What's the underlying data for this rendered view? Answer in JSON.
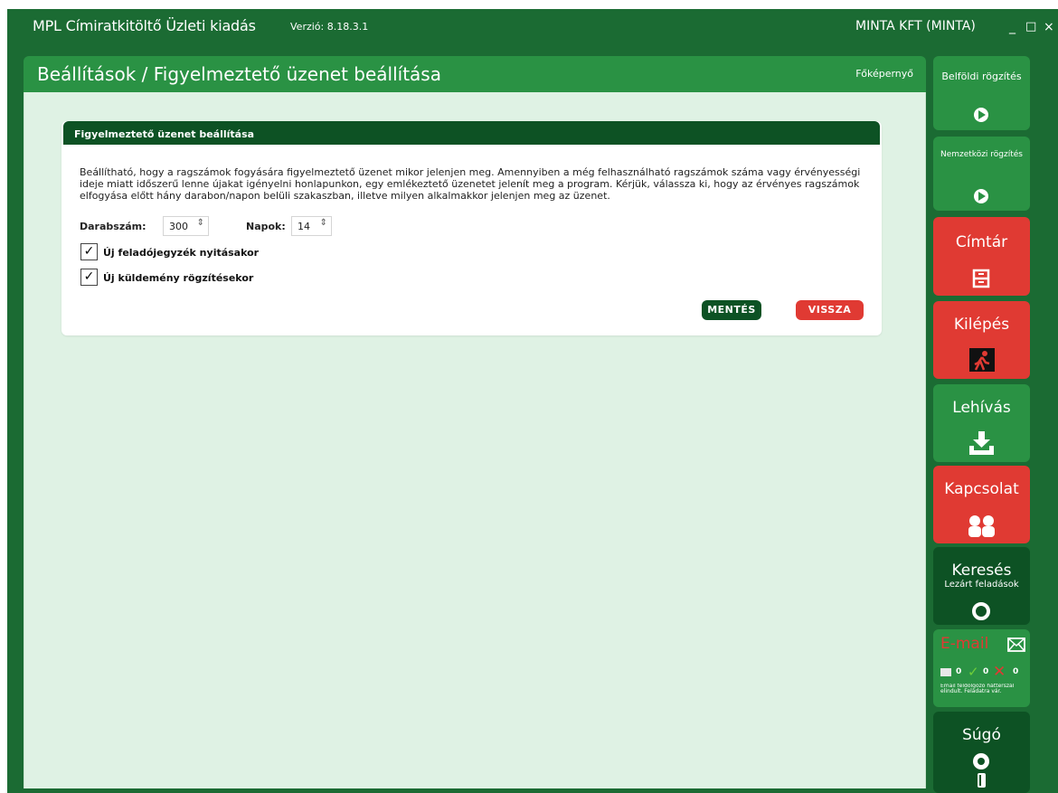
{
  "app": {
    "title": "MPL Címiratkitöltő Üzleti kiadás",
    "version": "Verzió: 8.18.3.1",
    "company": "MINTA KFT (MINTA)",
    "min_icon": "_",
    "max_icon": "□",
    "close_icon": "×"
  },
  "page": {
    "title": "Beállítások / Figyelmeztető üzenet beállítása",
    "home_link": "Főképernyő"
  },
  "panel": {
    "title": "Figyelmeztető üzenet beállítása",
    "description": "Beállítható, hogy a ragszámok fogyására figyelmeztető üzenet mikor jelenjen meg. Amennyiben a még felhasználható ragszámok száma vagy érvényességi ideje miatt időszerű lenne újakat igényelni honlapunkon, egy emlékeztető üzenetet jelenít meg a program. Kérjük, válassza ki, hogy az érvényes ragszámok elfogyása előtt hány darabon/napon belüli szakaszban, illetve milyen alkalmakkor jelenjen meg az üzenet.",
    "count_label": "Darabszám:",
    "count_value": "300",
    "days_label": "Napok:",
    "days_value": "14",
    "checkbox1_label": "Új feladójegyzék nyitásakor",
    "checkbox1_checked": true,
    "checkbox2_label": "Új küldemény rögzítésekor",
    "checkbox2_checked": true,
    "check_mark": "✓",
    "spin_arrows": "⌃⌄",
    "save_label": "MENTÉS",
    "back_label": "VISSZA"
  },
  "sidebar": {
    "domestic": "Belföldi rögzítés",
    "international": "Nemzetközi rögzítés",
    "directory": "Címtár",
    "exit": "Kilépés",
    "fetch": "Lehívás",
    "contact": "Kapcsolat",
    "search": "Keresés",
    "search_sub": "Lezárt feladások",
    "email": "E-mail",
    "email_count1": "0",
    "email_count2": "0",
    "email_count3": "0",
    "email_status": "Email feldolgozó háttérszál elindult. Feladatra vár.",
    "help": "Súgó"
  },
  "colors": {
    "frame": "#1b6b33",
    "green": "#2a9244",
    "dark_green": "#0d5224",
    "red": "#e03a33",
    "body_bg": "#dff2e4"
  }
}
